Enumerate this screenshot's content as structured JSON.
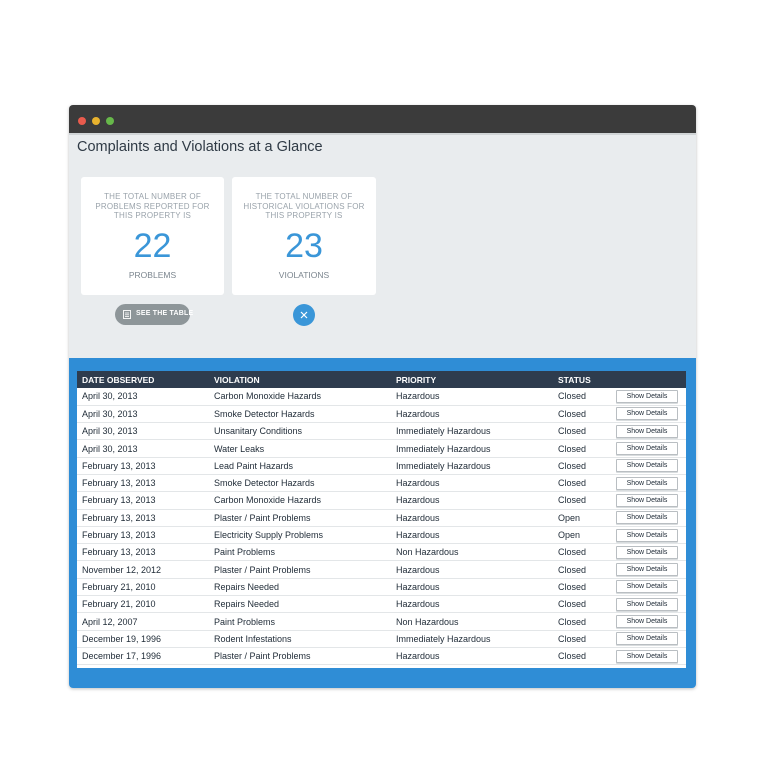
{
  "colors": {
    "close_dot": "#e95b4d",
    "minimize_dot": "#e8b22e",
    "maximize_dot": "#67b84a",
    "accent": "#3a96d8",
    "table_header_bg": "#2e3c4e",
    "panel_bg": "#2f8dd6"
  },
  "window": {
    "controls": [
      {
        "name": "close-dot",
        "color": "#e95b4d"
      },
      {
        "name": "minimize-dot",
        "color": "#e8b22e"
      },
      {
        "name": "maximize-dot",
        "color": "#67b84a"
      }
    ]
  },
  "page": {
    "title": "Complaints and Violations at a Glance"
  },
  "stats": [
    {
      "description": "The total number of problems reported for this property is",
      "value": "22",
      "unit": "Problems"
    },
    {
      "description": "The total number of historical violations for this property is",
      "value": "23",
      "unit": "Violations"
    }
  ],
  "actions": {
    "see_table_label": "SEE THE TABLE",
    "see_table_icon": "table-icon",
    "close_icon": "close-icon"
  },
  "table": {
    "columns": [
      "Date Observed",
      "Violation",
      "Priority",
      "Status",
      ""
    ],
    "details_label": "Show Details",
    "rows": [
      [
        "April 30, 2013",
        "Carbon Monoxide Hazards",
        "Hazardous",
        "Closed"
      ],
      [
        "April 30, 2013",
        "Smoke Detector Hazards",
        "Hazardous",
        "Closed"
      ],
      [
        "April 30, 2013",
        "Unsanitary Conditions",
        "Immediately Hazardous",
        "Closed"
      ],
      [
        "April 30, 2013",
        "Water Leaks",
        "Immediately Hazardous",
        "Closed"
      ],
      [
        "February 13, 2013",
        "Lead Paint Hazards",
        "Immediately Hazardous",
        "Closed"
      ],
      [
        "February 13, 2013",
        "Smoke Detector Hazards",
        "Hazardous",
        "Closed"
      ],
      [
        "February 13, 2013",
        "Carbon Monoxide Hazards",
        "Hazardous",
        "Closed"
      ],
      [
        "February 13, 2013",
        "Plaster / Paint Problems",
        "Hazardous",
        "Open"
      ],
      [
        "February 13, 2013",
        "Electricity Supply Problems",
        "Hazardous",
        "Open"
      ],
      [
        "February 13, 2013",
        "Paint Problems",
        "Non Hazardous",
        "Closed"
      ],
      [
        "November 12, 2012",
        "Plaster / Paint Problems",
        "Hazardous",
        "Closed"
      ],
      [
        "February 21, 2010",
        "Repairs Needed",
        "Hazardous",
        "Closed"
      ],
      [
        "February 21, 2010",
        "Repairs Needed",
        "Hazardous",
        "Closed"
      ],
      [
        "April 12, 2007",
        "Paint Problems",
        "Non Hazardous",
        "Closed"
      ],
      [
        "December 19, 1996",
        "Rodent Infestations",
        "Immediately Hazardous",
        "Closed"
      ],
      [
        "December 17, 1996",
        "Plaster / Paint Problems",
        "Hazardous",
        "Closed"
      ]
    ]
  }
}
